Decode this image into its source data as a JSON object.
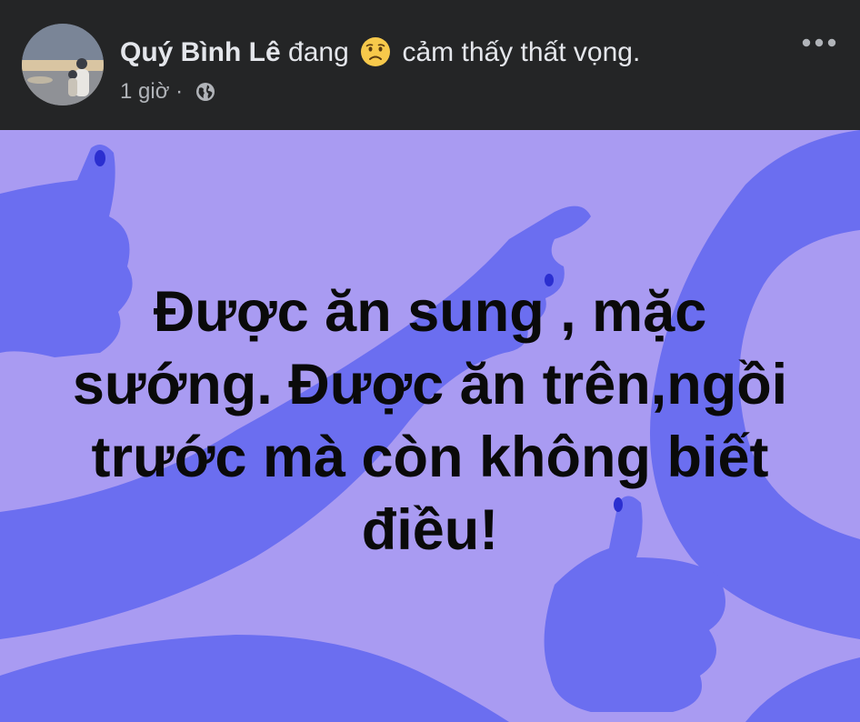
{
  "post": {
    "author_name": "Quý Bình Lê",
    "feeling_prefix": "đang",
    "feeling_emoji": "disappointed-face-icon",
    "feeling_text": "cảm thấy thất vọng.",
    "time": "1 giờ",
    "separator": "·",
    "privacy_icon": "globe-icon",
    "more_icon": "more-dots-icon",
    "status_text": "Được ăn sung , mặc sướng. Được ăn trên,ngồi trước mà còn không biết điều!"
  },
  "colors": {
    "header_bg": "#242526",
    "post_bg": "#a99bf2",
    "hand_shape": "#6b6ef0",
    "text": "#0a0a0a",
    "name_text": "#e4e6eb",
    "meta_text": "#b0b3b8"
  }
}
